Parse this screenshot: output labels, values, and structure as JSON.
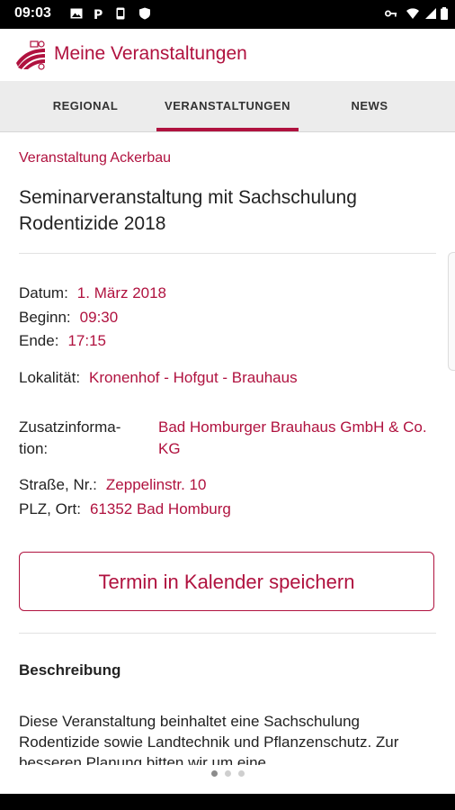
{
  "status_bar": {
    "time": "09:03",
    "left_icons": [
      "image-icon",
      "parking-icon",
      "phone-icon",
      "shield-icon"
    ],
    "right_icons": [
      "key-icon",
      "wifi-icon",
      "signal-icon",
      "battery-icon"
    ]
  },
  "app_bar": {
    "title": "Meine Veranstaltungen"
  },
  "tabs": [
    {
      "label": "REGIONAL",
      "selected": false
    },
    {
      "label": "VERANSTALTUNGEN",
      "selected": true
    },
    {
      "label": "NEWS",
      "selected": false
    }
  ],
  "event": {
    "category": "Veranstaltung Ackerbau",
    "title": "Seminarveranstaltung mit Sachschulung Rodentizide 2018",
    "date_label": "Datum:",
    "date_value": "1. März 2018",
    "begin_label": "Beginn:",
    "begin_value": "09:30",
    "end_label": "Ende:",
    "end_value": "17:15",
    "location_label": "Lokalität:",
    "location_value": "Kronenhof - Hofgut - Brauhaus",
    "info_label": "Zusatzinforma-tion:",
    "info_value": "Bad Homburger Brauhaus GmbH & Co. KG",
    "street_label": "Straße, Nr.:",
    "street_value": "Zeppelinstr. 10",
    "city_label": "PLZ, Ort:",
    "city_value": "61352 Bad Homburg"
  },
  "calendar_button": "Termin in Kalender speichern",
  "description": {
    "heading": "Beschreibung",
    "text": "Diese Veranstaltung beinhaltet eine Sachschulung Rodentizide sowie Landtechnik und Pflanzenschutz. Zur besseren Planung bitten wir um eine"
  },
  "pager": {
    "count": 3,
    "active": 1
  },
  "colors": {
    "accent": "#b0123f",
    "tab_bar": "#ececec"
  }
}
